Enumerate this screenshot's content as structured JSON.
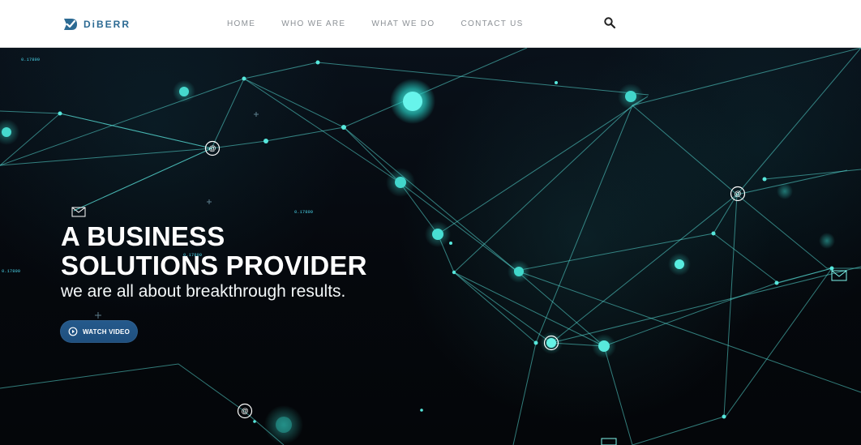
{
  "header": {
    "logo_text": "DiBERR",
    "logo_icon": "checkmark-logo-icon",
    "nav": [
      {
        "label": "HOME"
      },
      {
        "label": "WHO WE ARE"
      },
      {
        "label": "WHAT WE DO"
      },
      {
        "label": "CONTACT US"
      }
    ],
    "search_icon": "search-icon",
    "colors": {
      "brand_blue": "#2c6a93",
      "nav_gray": "#8c9196"
    }
  },
  "hero": {
    "title_line_1": "A BUSINESS",
    "title_line_2": "SOLUTIONS PROVIDER",
    "subtitle": "we are all about breakthrough results.",
    "button_label": "WATCH VIDEO",
    "button_icon": "play-circle-icon",
    "network_labels": [
      "0.17899",
      "0.17899",
      "0.17899",
      "0.17899"
    ],
    "colors": {
      "background": "#05070c",
      "accent_teal": "#59f1e4",
      "button_blue": "#255a8c"
    }
  }
}
